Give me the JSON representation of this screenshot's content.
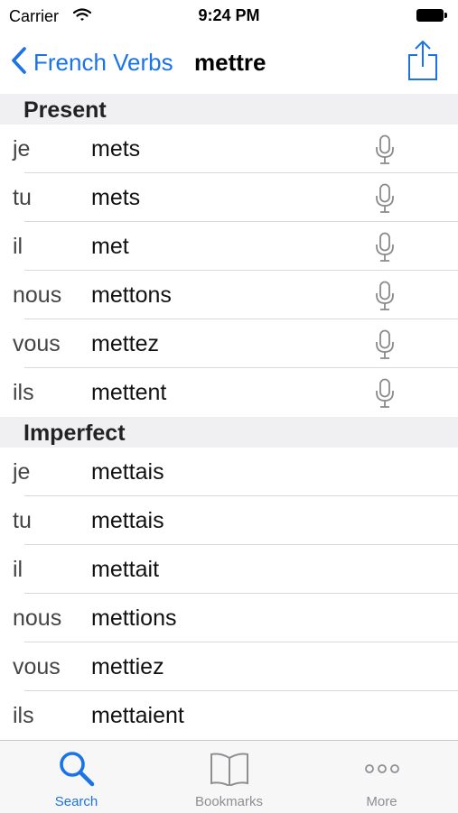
{
  "status_bar": {
    "carrier": "Carrier",
    "time": "9:24 PM"
  },
  "nav": {
    "back_label": "French Verbs",
    "title": "mettre"
  },
  "sections": [
    {
      "title": "Present",
      "rows": [
        {
          "pronoun": "je",
          "form": "mets"
        },
        {
          "pronoun": "tu",
          "form": "mets"
        },
        {
          "pronoun": "il",
          "form": "met"
        },
        {
          "pronoun": "nous",
          "form": "mettons"
        },
        {
          "pronoun": "vous",
          "form": "mettez"
        },
        {
          "pronoun": "ils",
          "form": "mettent"
        }
      ]
    },
    {
      "title": "Imperfect",
      "rows": [
        {
          "pronoun": "je",
          "form": "mettais"
        },
        {
          "pronoun": "tu",
          "form": "mettais"
        },
        {
          "pronoun": "il",
          "form": "mettait"
        },
        {
          "pronoun": "nous",
          "form": "mettions"
        },
        {
          "pronoun": "vous",
          "form": "mettiez"
        },
        {
          "pronoun": "ils",
          "form": "mettaient"
        }
      ]
    }
  ],
  "tab_bar": {
    "tabs": [
      {
        "label": "Search",
        "icon": "search-icon",
        "active": true
      },
      {
        "label": "Bookmarks",
        "icon": "book-icon",
        "active": false
      },
      {
        "label": "More",
        "icon": "more-icon",
        "active": false
      }
    ]
  },
  "colors": {
    "accent": "#1a73e8",
    "section_bg": "#f0f0f2",
    "inactive": "#8e8e93"
  }
}
